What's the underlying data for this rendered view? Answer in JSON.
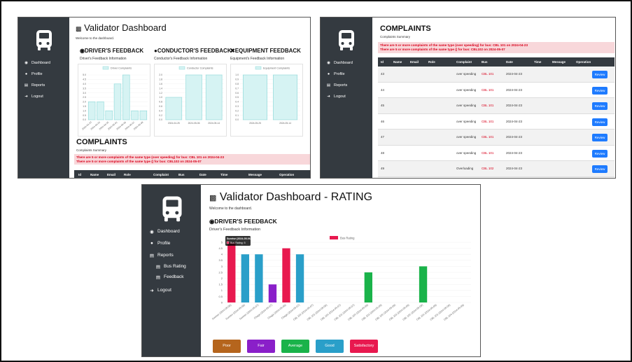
{
  "colors": {
    "sidebar": "#343a40",
    "chart_fill": "#d6f3f3",
    "chart_border": "#8ad8d8",
    "alert_bg": "#f8d7da",
    "alert_text": "#d9001b",
    "review": "#1e7bff"
  },
  "nav_icons": {
    "dashboard": "dashboard-icon",
    "profile": "user-icon",
    "reports": "reports-icon",
    "logout": "logout-icon",
    "bus_rating": "list-icon",
    "feedback": "list-icon"
  },
  "panel1": {
    "title": "Validator Dashboard",
    "welcome": "Welcome to the dashboard.",
    "nav": [
      "Dashboard",
      "Profile",
      "Reports",
      "Logout"
    ],
    "sections": [
      {
        "heading": "DRIVER'S FEEDBACK",
        "subtitle": "Driver's Feedback Information",
        "legend": "Driver Complaints"
      },
      {
        "heading": "CONDUCTOR'S FEEDBACK",
        "subtitle": "Conductor's Feedback Information",
        "legend": "Conductor Complaints"
      },
      {
        "heading": "EQUIPMENT FEEDBACK",
        "subtitle": "Equipment's Feedback Information",
        "legend": "Equipment Complaints"
      }
    ],
    "complaints_title": "COMPLAINTS",
    "complaints_sub": "Complaints Summary",
    "alert1": "There are 5 or more complaints of the same type (over speeding) for bus: CBL 101 on 2024-04-23",
    "alert2": "There are 5 or more complaints of the same type () for bus: CBL102 on 2024-05-07",
    "headers": [
      "Id",
      "Name",
      "Email",
      "Role",
      "Complaint",
      "Bus",
      "Date",
      "Time",
      "Message",
      "Operation"
    ]
  },
  "panel2": {
    "nav": [
      "Dashboard",
      "Profile",
      "Reports",
      "Logout"
    ],
    "title": "COMPLAINTS",
    "sub": "Complaints Summary",
    "alert1": "There are 5 or more complaints of the same type (over speeding) for bus: CBL 101 on 2024-04-23",
    "alert2": "There are 5 or more complaints of the same type () for bus: CBL102 on 2024-05-07",
    "headers": [
      "Id",
      "Name",
      "Email",
      "Role",
      "Complaint",
      "Bus",
      "Date",
      "Time",
      "Message",
      "Operation"
    ],
    "rows": [
      {
        "id": "43",
        "complaint": "over speeding",
        "bus": "CBL 101",
        "date": "2024-04-23",
        "op": "Review"
      },
      {
        "id": "44",
        "complaint": "over speeding",
        "bus": "CBL 101",
        "date": "2024-04-23",
        "op": "Review"
      },
      {
        "id": "45",
        "complaint": "over speeding",
        "bus": "CBL 101",
        "date": "2024-04-23",
        "op": "Review"
      },
      {
        "id": "46",
        "complaint": "over speeding",
        "bus": "CBL 101",
        "date": "2024-04-23",
        "op": "Review"
      },
      {
        "id": "47",
        "complaint": "over speeding",
        "bus": "CBL 101",
        "date": "2024-04-23",
        "op": "Review"
      },
      {
        "id": "48",
        "complaint": "over speeding",
        "bus": "CBL 101",
        "date": "2024-04-23",
        "op": "Review"
      },
      {
        "id": "49",
        "complaint": "Overloading",
        "bus": "CBL 102",
        "date": "2024-04-23",
        "op": "Review"
      }
    ]
  },
  "panel3": {
    "title": "Validator Dashboard - RATING",
    "welcome": "Welcome to the dashboard.",
    "nav": [
      "Dashboard",
      "Profile",
      "Reports",
      "Logout"
    ],
    "subnav": [
      "Bus Rating",
      "Feedback"
    ],
    "section": "DRIVER'S FEEDBACK",
    "section_sub": "Driver's Feedback Information",
    "legend": "Bus Rating",
    "tooltip_title": "Sunrise (2024-05-06)",
    "tooltip_value": "Bus Rating: 5",
    "rating_buttons": [
      {
        "label": "Poor",
        "color": "#b5651d"
      },
      {
        "label": "Fair",
        "color": "#8a1fc9"
      },
      {
        "label": "Average",
        "color": "#1ab34a"
      },
      {
        "label": "Good",
        "color": "#2a9fc9"
      },
      {
        "label": "Satisfactory",
        "color": "#e8194f"
      }
    ]
  },
  "chart_data": [
    {
      "type": "bar",
      "title": "DRIVER'S FEEDBACK",
      "series": [
        {
          "name": "Driver Complaints",
          "values": [
            2,
            2,
            1,
            4,
            5,
            1,
            1
          ]
        }
      ],
      "categories": [
        "2024-04-23",
        "2024-04-24",
        "2024-04-25",
        "2024-05-01",
        "2024-05-06",
        "2024-05-07",
        "2024-05-08"
      ],
      "ylim": [
        0,
        5
      ],
      "yticks": [
        0,
        0.5,
        1.0,
        1.5,
        2.0,
        2.5,
        3.0,
        3.5,
        4.0,
        4.5,
        5.0
      ]
    },
    {
      "type": "bar",
      "title": "CONDUCTOR'S FEEDBACK",
      "series": [
        {
          "name": "Conductor Complaints",
          "values": [
            1,
            2,
            2
          ]
        }
      ],
      "categories": [
        "2024-04-25",
        "2024-05-06",
        "2024-05-14"
      ],
      "ylim": [
        0,
        2
      ],
      "yticks": [
        0,
        0.2,
        0.4,
        0.6,
        0.8,
        1.0,
        1.2,
        1.4,
        1.6,
        1.8,
        2.0
      ]
    },
    {
      "type": "bar",
      "title": "EQUIPMENT FEEDBACK",
      "series": [
        {
          "name": "Equipment Complaints",
          "values": [
            1,
            1
          ]
        }
      ],
      "categories": [
        "2024-05-25",
        "2024-05-14"
      ],
      "ylim": [
        0,
        1
      ],
      "yticks": [
        0,
        0.1,
        0.2,
        0.3,
        0.4,
        0.5,
        0.6,
        0.7,
        0.8,
        0.9,
        1.0
      ]
    },
    {
      "type": "bar",
      "title": "DRIVER'S FEEDBACK",
      "series": [
        {
          "name": "Bus Rating",
          "values": [
            5,
            4,
            4,
            1.5,
            4.5,
            4,
            0,
            0,
            0,
            0,
            2.5,
            0,
            0,
            0,
            3,
            0,
            0,
            0
          ]
        }
      ],
      "bar_colors": [
        "#e8194f",
        "#2a9fc9",
        "#2a9fc9",
        "#8a1fc9",
        "#e8194f",
        "#2a9fc9",
        "#1ab34a",
        "#1ab34a",
        "#1ab34a",
        "#1ab34a",
        "#1ab34a",
        "#1ab34a",
        "#1ab34a",
        "#1ab34a",
        "#1ab34a",
        "#1ab34a",
        "#1ab34a",
        "#1ab34a"
      ],
      "categories": [
        "Sunrise (2024-05-06)",
        "Sunrise (2024-05-06)",
        "Sunrise (2024-05-07)",
        "Chaga (2024-05-07)",
        "Chaga (2024-05-06)",
        "Chaga (2024-05-07)",
        "CBL 102 (2024-05-07)",
        "CBL 101 (2024-05-06)",
        "CBL 101 (2024-05-07)",
        "CBL 101 (2024-05-07)",
        "CBL 103 (2024-05-09)",
        "CBL 102 (2024-05-09)",
        "CBL 102 (2024-05-09)",
        "CBL 102 (2024-05-09)",
        "CBL 102 (2024-05-09)",
        "CBL 101 (2024-05-09)",
        "CBL 101 (2024-05-09)",
        "CBL 104 (2024-05-09)"
      ],
      "ylim": [
        0,
        5
      ],
      "yticks": [
        0,
        0.5,
        1.0,
        1.5,
        2.0,
        2.5,
        3.0,
        3.5,
        4.0,
        4.5,
        5.0
      ]
    }
  ]
}
